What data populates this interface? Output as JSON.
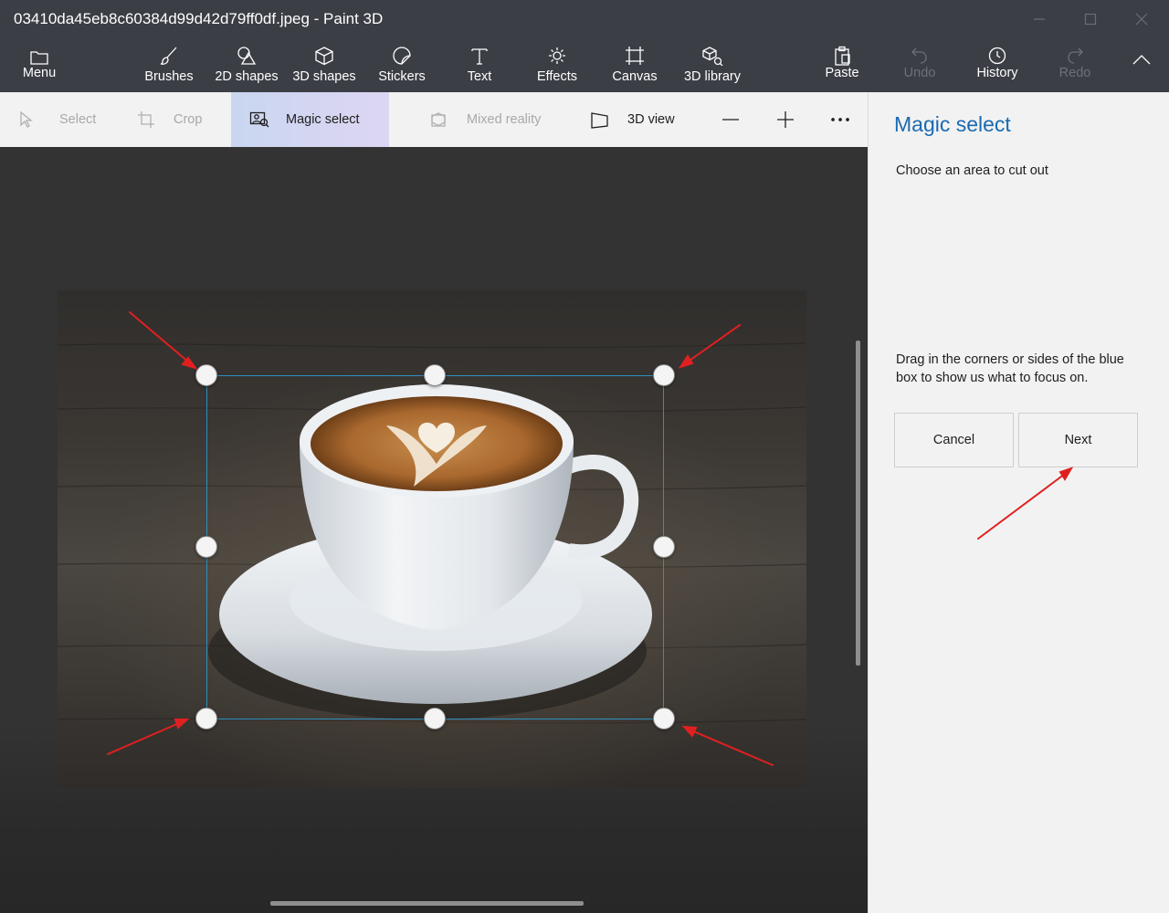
{
  "window": {
    "title": "03410da45eb8c60384d99d42d79ff0df.jpeg - Paint 3D"
  },
  "ribbon": {
    "menu": "Menu",
    "brushes": "Brushes",
    "shapes2d": "2D shapes",
    "shapes3d": "3D shapes",
    "stickers": "Stickers",
    "text": "Text",
    "effects": "Effects",
    "canvas": "Canvas",
    "library3d": "3D library",
    "paste": "Paste",
    "undo": "Undo",
    "history": "History",
    "redo": "Redo"
  },
  "toolbar": {
    "select": "Select",
    "crop": "Crop",
    "magic_select": "Magic select",
    "mixed_reality": "Mixed reality",
    "view3d": "3D view"
  },
  "panel": {
    "title": "Magic select",
    "subtitle": "Choose an area to cut out",
    "help": "Drag in the corners or sides of the blue box to show us what to focus on.",
    "cancel": "Cancel",
    "next": "Next"
  },
  "colors": {
    "chrome": "#3b3e45",
    "accent": "#1a6ab1",
    "selection": "#2e8fbf",
    "annotation_arrow": "#e02020"
  }
}
